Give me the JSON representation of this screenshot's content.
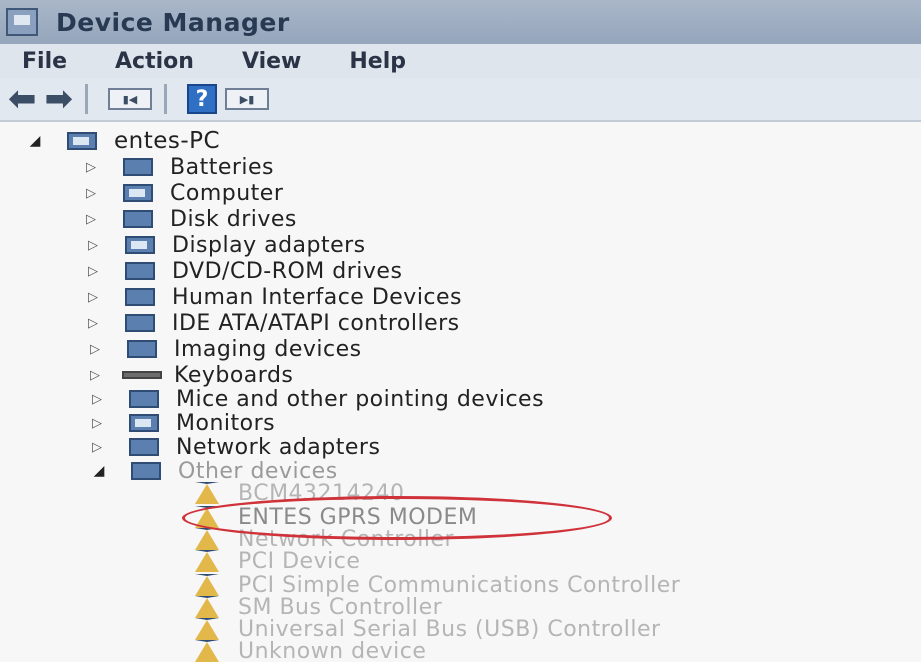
{
  "window": {
    "title": "Device Manager"
  },
  "menu": {
    "items": [
      "File",
      "Action",
      "View",
      "Help"
    ]
  },
  "toolbar": {
    "back_icon": "back-arrow-icon",
    "forward_icon": "forward-arrow-icon",
    "help_glyph": "?"
  },
  "tree": {
    "root": "entes-PC",
    "categories": [
      "Batteries",
      "Computer",
      "Disk drives",
      "Display adapters",
      "DVD/CD-ROM drives",
      "Human Interface Devices",
      "IDE ATA/ATAPI controllers",
      "Imaging devices",
      "Keyboards",
      "Mice and other pointing devices",
      "Monitors",
      "Network adapters",
      "Other devices"
    ],
    "other_devices": [
      "BCM43214240",
      "ENTES GPRS MODEM",
      "Network Controller",
      "PCI Device",
      "PCI Simple Communications Controller",
      "SM Bus Controller",
      "Universal Serial Bus (USB) Controller",
      "Unknown device"
    ],
    "highlighted_item": "ENTES GPRS MODEM",
    "highlight_color": "#d0323a"
  }
}
